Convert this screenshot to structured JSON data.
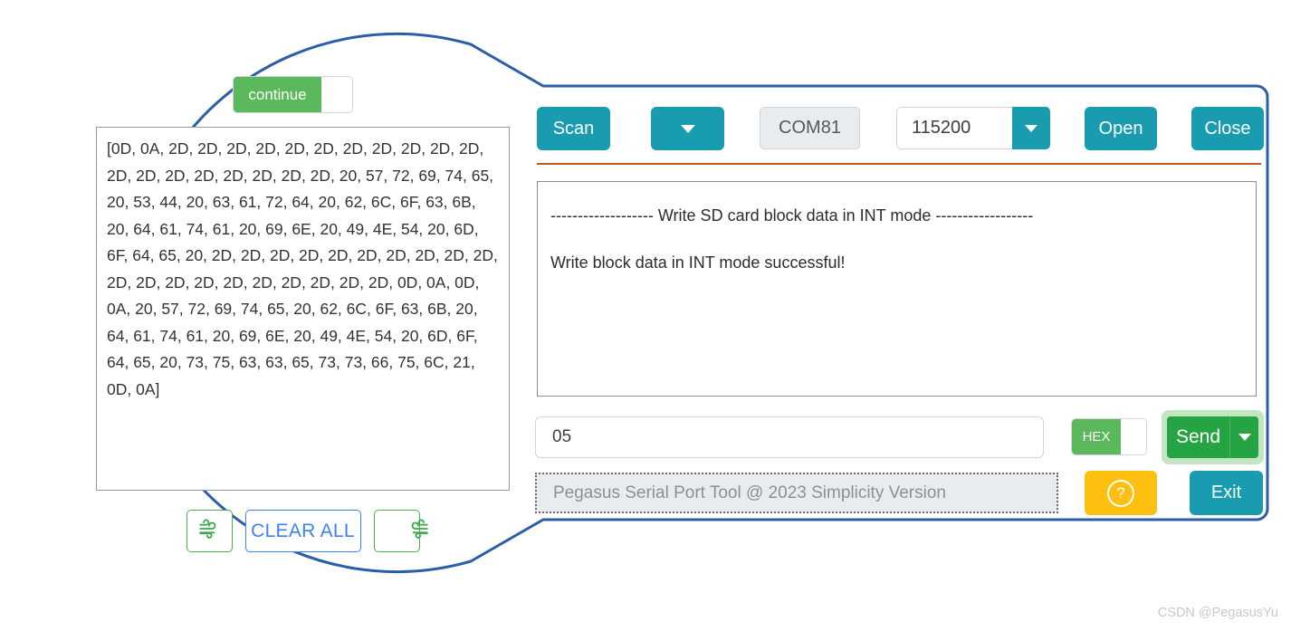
{
  "zoom_region": {
    "continue_toggle": {
      "label": "continue",
      "state": "on"
    },
    "hexdump": {
      "text": "[0D, 0A, 2D, 2D, 2D, 2D, 2D, 2D, 2D, 2D, 2D, 2D, 2D, 2D, 2D, 2D, 2D, 2D, 2D, 2D, 2D, 20, 57, 72, 69, 74, 65, 20, 53, 44, 20, 63, 61, 72, 64, 20, 62, 6C, 6F, 63, 6B, 20, 64, 61, 74, 61, 20, 69, 6E, 20, 49, 4E, 54, 20, 6D, 6F, 64, 65, 20, 2D, 2D, 2D, 2D, 2D, 2D, 2D, 2D, 2D, 2D, 2D, 2D, 2D, 2D, 2D, 2D, 2D, 2D, 2D, 2D, 0D, 0A, 0D, 0A, 20, 57, 72, 69, 74, 65, 20, 62, 6C, 6F, 63, 6B, 20, 64, 61, 74, 61, 20, 69, 6E, 20, 49, 4E, 54, 20, 6D, 6F, 64, 65, 20, 73, 75, 63, 63, 65, 73, 73, 66, 75, 6C, 21, 0D, 0A]"
    },
    "buttons": {
      "clear_all": "CLEAR ALL",
      "left_icon": "wind-left-icon",
      "right_icon": "wind-right-icon"
    }
  },
  "app": {
    "toolbar": {
      "scan_label": "Scan",
      "port_dropdown_icon": "chevron-down-icon",
      "port_value": "COM81",
      "baud_value": "115200",
      "baud_dropdown_icon": "chevron-down-icon",
      "open_label": "Open",
      "close_label": "Close"
    },
    "receive": {
      "lines": [
        "------------------- Write SD card block data in INT mode ------------------",
        "",
        "Write block data in INT mode successful!"
      ]
    },
    "send": {
      "input_value": "05",
      "input_placeholder": "",
      "hex_label": "HEX",
      "hex_state": "on",
      "send_label": "Send",
      "send_dropdown_icon": "chevron-down-icon"
    },
    "status": {
      "text": "Pegasus Serial Port Tool @ 2023 Simplicity Version",
      "help_label": "?",
      "exit_label": "Exit"
    }
  },
  "watermark": {
    "text": "CSDN @PegasusYu"
  },
  "colors": {
    "teal": "#1a9cb0",
    "green": "#5cb85c",
    "send_green": "#26a342",
    "amber": "#fdc010",
    "callout_blue": "#2a5fa8",
    "divider_orange": "#bf5a1c",
    "link_blue": "#3b82f6"
  }
}
